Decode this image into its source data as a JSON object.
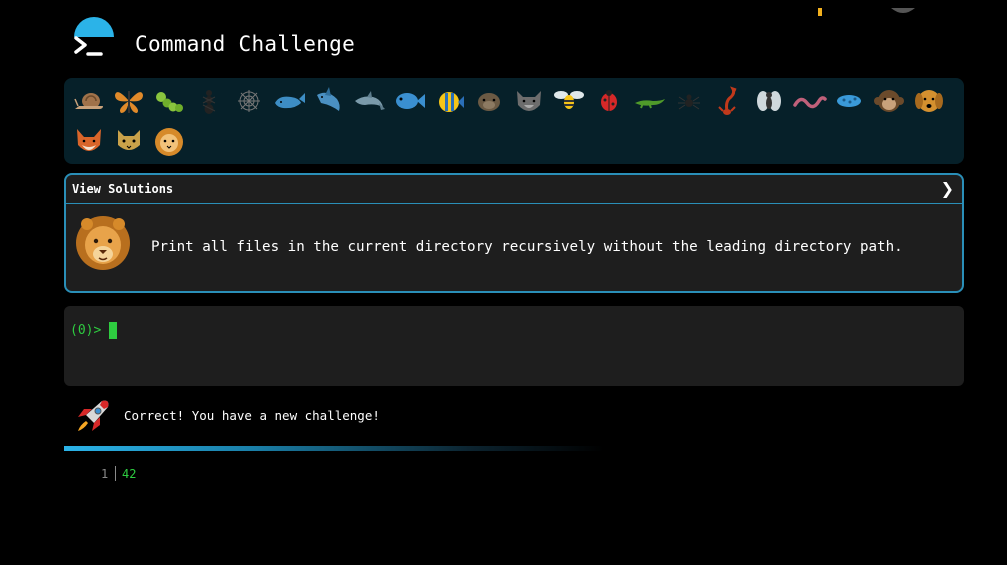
{
  "header": {
    "title": "Command Challenge",
    "logo_icon": "terminal-prompt-icon",
    "accent_color": "#2bb3e8"
  },
  "creatures": [
    {
      "name": "snail"
    },
    {
      "name": "butterfly"
    },
    {
      "name": "caterpillar"
    },
    {
      "name": "ant"
    },
    {
      "name": "spider-web"
    },
    {
      "name": "whale"
    },
    {
      "name": "shark"
    },
    {
      "name": "dolphin"
    },
    {
      "name": "fish"
    },
    {
      "name": "tropical-fish"
    },
    {
      "name": "otter"
    },
    {
      "name": "wolf"
    },
    {
      "name": "bee"
    },
    {
      "name": "ladybug"
    },
    {
      "name": "lizard"
    },
    {
      "name": "spider"
    },
    {
      "name": "scorpion"
    },
    {
      "name": "fly"
    },
    {
      "name": "worm"
    },
    {
      "name": "microbe"
    },
    {
      "name": "monkey"
    },
    {
      "name": "dog"
    },
    {
      "name": "fox"
    },
    {
      "name": "cat"
    },
    {
      "name": "lion"
    }
  ],
  "challenge": {
    "view_solutions_label": "View Solutions",
    "chevron": "❯",
    "avatar_icon": "lion-icon",
    "text": "Print all files in the current directory recursively without the leading directory path."
  },
  "terminal": {
    "prompt": "(0)>",
    "input_value": ""
  },
  "status": {
    "icon": "rocket-icon",
    "message": "Correct! You have a new challenge!"
  },
  "output": {
    "lines": [
      {
        "number": "1",
        "value": "42"
      }
    ]
  }
}
